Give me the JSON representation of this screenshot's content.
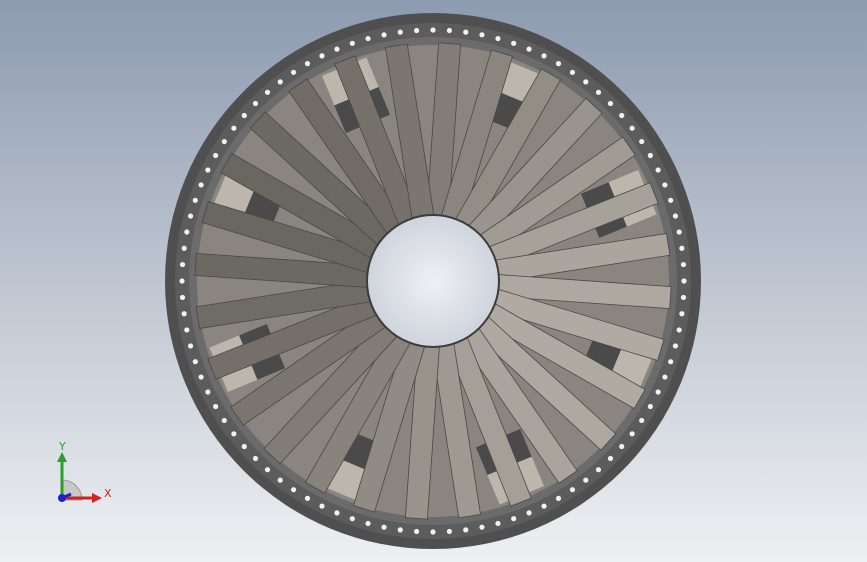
{
  "viewport": {
    "background_top": "#8d9bb0",
    "background_bottom": "#eef0f3"
  },
  "model": {
    "type": "radial-impeller",
    "blade_count": 28,
    "bolt_hole_count": 96,
    "colors": {
      "ring_outer": "#4f4f4f",
      "ring_inner": "#6b6b6b",
      "bolt_hole": "#f2f2f2",
      "blade_light": "#b0aaa2",
      "blade_dark": "#6a6660",
      "gusset_light": "#bdb6ad",
      "gusset_dark": "#4a4a4a"
    }
  },
  "triad": {
    "y_label": "Y",
    "x_label": "X",
    "y_color": "#2aa02a",
    "x_color": "#d42020",
    "z_color": "#2020d0"
  }
}
